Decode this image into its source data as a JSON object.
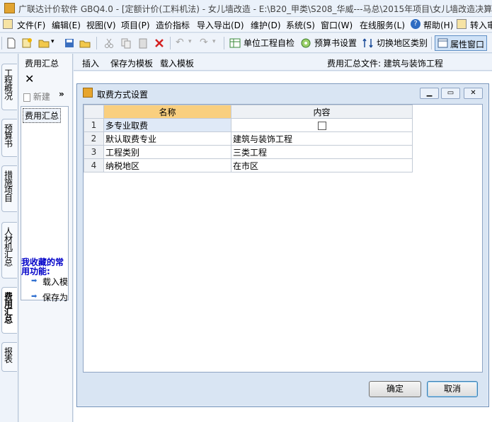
{
  "window": {
    "title": "广联达计价软件 GBQ4.0 - [定额计价(工料机法) - 女儿墙改造 - E:\\B20_甲类\\S208_华威---马总\\2015年项目\\女儿墙改造决算"
  },
  "menu": {
    "items": [
      "文件(F)",
      "编辑(E)",
      "视图(V)",
      "项目(P)",
      "造价指标",
      "导入导出(D)",
      "维护(D)",
      "系统(S)",
      "窗口(W)",
      "在线服务(L)",
      "帮助(H)",
      "转入审"
    ]
  },
  "toolbar": {
    "unit_check": "单位工程自检",
    "budget_settings": "预算书设置",
    "switch_region": "切换地区类别",
    "attr_window": "属性窗口"
  },
  "vtabs": [
    "工程概况",
    "预算书",
    "措施项目",
    "人材机汇总",
    "费用汇总",
    "报表"
  ],
  "left_panel": {
    "header": "费用汇总",
    "new_label": "新建",
    "more": "»",
    "selected_item": "费用汇总",
    "fav_title": "我收藏的常用功能:",
    "fav_items": [
      "载入模",
      "保存为"
    ]
  },
  "main_header": {
    "insert": "插入",
    "save_template": "保存为模板",
    "load_template": "载入模板",
    "file_label": "费用汇总文件: 建筑与装饰工程"
  },
  "dialog": {
    "title": "取费方式设置",
    "col_name": "名称",
    "col_content": "内容",
    "rows": [
      {
        "no": "1",
        "name": "多专业取费",
        "content": ""
      },
      {
        "no": "2",
        "name": "默认取费专业",
        "content": "建筑与装饰工程"
      },
      {
        "no": "3",
        "name": "工程类别",
        "content": "三类工程"
      },
      {
        "no": "4",
        "name": "纳税地区",
        "content": "在市区"
      }
    ],
    "ok": "确定",
    "cancel": "取消"
  }
}
